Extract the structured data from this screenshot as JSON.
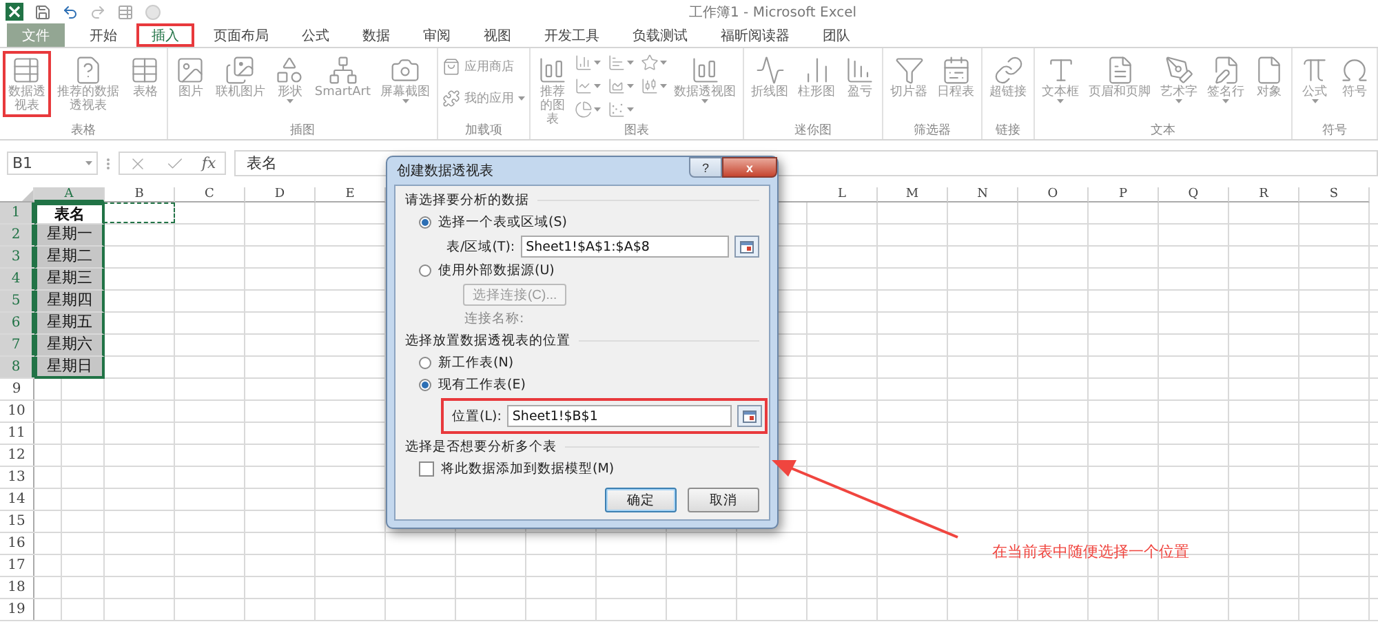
{
  "title_bar": {
    "title": "工作簿1 - Microsoft Excel"
  },
  "tabs": [
    {
      "label": "文件",
      "kind": "file",
      "selected": false,
      "highlighted": false
    },
    {
      "label": "开始",
      "kind": "tab",
      "selected": false,
      "highlighted": false
    },
    {
      "label": "插入",
      "kind": "tab",
      "selected": true,
      "highlighted": true
    },
    {
      "label": "页面布局",
      "kind": "tab",
      "selected": false,
      "highlighted": false
    },
    {
      "label": "公式",
      "kind": "tab",
      "selected": false,
      "highlighted": false
    },
    {
      "label": "数据",
      "kind": "tab",
      "selected": false,
      "highlighted": false
    },
    {
      "label": "审阅",
      "kind": "tab",
      "selected": false,
      "highlighted": false
    },
    {
      "label": "视图",
      "kind": "tab",
      "selected": false,
      "highlighted": false
    },
    {
      "label": "开发工具",
      "kind": "tab",
      "selected": false,
      "highlighted": false
    },
    {
      "label": "负载测试",
      "kind": "tab",
      "selected": false,
      "highlighted": false
    },
    {
      "label": "福昕阅读器",
      "kind": "tab",
      "selected": false,
      "highlighted": false
    },
    {
      "label": "团队",
      "kind": "tab",
      "selected": false,
      "highlighted": false
    }
  ],
  "ribbon_groups": [
    {
      "label": "表格",
      "buttons": [
        {
          "kind": "large",
          "label": "数据透视表",
          "dropdown": false,
          "highlighted": true
        },
        {
          "kind": "large",
          "label": "推荐的数据透视表",
          "dropdown": false,
          "highlighted": false
        },
        {
          "kind": "large",
          "label": "表格",
          "dropdown": false,
          "highlighted": false
        }
      ]
    },
    {
      "label": "插图",
      "buttons": [
        {
          "kind": "large",
          "label": "图片",
          "dropdown": false,
          "highlighted": false
        },
        {
          "kind": "large",
          "label": "联机图片",
          "dropdown": false,
          "highlighted": false
        },
        {
          "kind": "large",
          "label": "形状",
          "dropdown": true,
          "highlighted": false
        },
        {
          "kind": "large",
          "label": "SmartArt",
          "dropdown": false,
          "highlighted": false
        },
        {
          "kind": "large",
          "label": "屏幕截图",
          "dropdown": true,
          "highlighted": false
        }
      ]
    },
    {
      "label": "加载项",
      "buttons": [
        {
          "kind": "small",
          "label": "应用商店",
          "dropdown": false,
          "highlighted": false
        },
        {
          "kind": "small",
          "label": "我的应用",
          "dropdown": true,
          "highlighted": false
        }
      ]
    },
    {
      "label": "图表",
      "buttons": [
        {
          "kind": "large",
          "label": "推荐的图表",
          "dropdown": false,
          "highlighted": false
        },
        {
          "kind": "icon",
          "dropdown": true,
          "highlighted": false
        },
        {
          "kind": "icon",
          "dropdown": true,
          "highlighted": false
        },
        {
          "kind": "icon",
          "dropdown": true,
          "highlighted": false
        },
        {
          "kind": "icon",
          "dropdown": true,
          "highlighted": false
        },
        {
          "kind": "icon",
          "dropdown": true,
          "highlighted": false
        },
        {
          "kind": "icon",
          "dropdown": true,
          "highlighted": false
        },
        {
          "kind": "icon",
          "dropdown": true,
          "highlighted": false
        },
        {
          "kind": "icon",
          "dropdown": true,
          "highlighted": false
        },
        {
          "kind": "large",
          "label": "数据透视图",
          "dropdown": true,
          "highlighted": false
        }
      ]
    },
    {
      "label": "迷你图",
      "buttons": [
        {
          "kind": "large",
          "label": "折线图",
          "dropdown": false,
          "highlighted": false
        },
        {
          "kind": "large",
          "label": "柱形图",
          "dropdown": false,
          "highlighted": false
        },
        {
          "kind": "large",
          "label": "盈亏",
          "dropdown": false,
          "highlighted": false
        }
      ]
    },
    {
      "label": "筛选器",
      "buttons": [
        {
          "kind": "large",
          "label": "切片器",
          "dropdown": false,
          "highlighted": false
        },
        {
          "kind": "large",
          "label": "日程表",
          "dropdown": false,
          "highlighted": false
        }
      ]
    },
    {
      "label": "链接",
      "buttons": [
        {
          "kind": "large",
          "label": "超链接",
          "dropdown": false,
          "highlighted": false
        }
      ]
    },
    {
      "label": "文本",
      "buttons": [
        {
          "kind": "large",
          "label": "文本框",
          "dropdown": true,
          "highlighted": false
        },
        {
          "kind": "large",
          "label": "页眉和页脚",
          "dropdown": false,
          "highlighted": false
        },
        {
          "kind": "large",
          "label": "艺术字",
          "dropdown": true,
          "highlighted": false
        },
        {
          "kind": "large",
          "label": "签名行",
          "dropdown": true,
          "highlighted": false
        },
        {
          "kind": "large",
          "label": "对象",
          "dropdown": false,
          "highlighted": false
        }
      ]
    },
    {
      "label": "符号",
      "buttons": [
        {
          "kind": "large",
          "label": "公式",
          "dropdown": true,
          "highlighted": false
        },
        {
          "kind": "large",
          "label": "符号",
          "dropdown": false,
          "highlighted": false
        }
      ]
    }
  ],
  "formula_bar": {
    "name_box": "B1",
    "fx_label": "fx",
    "content": "表名"
  },
  "sheet": {
    "columns_left": [
      {
        "label": "A",
        "selected": true
      },
      {
        "label": "B",
        "selected": false
      },
      {
        "label": "C",
        "selected": false
      },
      {
        "label": "D",
        "selected": false
      },
      {
        "label": "E",
        "selected": false
      }
    ],
    "columns_right": [
      {
        "label": "L",
        "selected": false
      },
      {
        "label": "M",
        "selected": false
      },
      {
        "label": "N",
        "selected": false
      },
      {
        "label": "O",
        "selected": false
      },
      {
        "label": "P",
        "selected": false
      },
      {
        "label": "Q",
        "selected": false
      },
      {
        "label": "R",
        "selected": false
      },
      {
        "label": "S",
        "selected": false
      }
    ],
    "rows": [
      {
        "label": "1",
        "selected": true,
        "cells": [
          {
            "text": "表名",
            "selected": true,
            "active": true,
            "bold": true
          },
          {
            "copy_marquee": true
          }
        ]
      },
      {
        "label": "2",
        "selected": true,
        "cells": [
          {
            "text": "星期一",
            "selected": true,
            "active": false,
            "bold": false
          }
        ]
      },
      {
        "label": "3",
        "selected": true,
        "cells": [
          {
            "text": "星期二",
            "selected": true,
            "active": false,
            "bold": false
          }
        ]
      },
      {
        "label": "4",
        "selected": true,
        "cells": [
          {
            "text": "星期三",
            "selected": true,
            "active": false,
            "bold": false
          }
        ]
      },
      {
        "label": "5",
        "selected": true,
        "cells": [
          {
            "text": "星期四",
            "selected": true,
            "active": false,
            "bold": false
          }
        ]
      },
      {
        "label": "6",
        "selected": true,
        "cells": [
          {
            "text": "星期五",
            "selected": true,
            "active": false,
            "bold": false
          }
        ]
      },
      {
        "label": "7",
        "selected": true,
        "cells": [
          {
            "text": "星期六",
            "selected": true,
            "active": false,
            "bold": false
          }
        ]
      },
      {
        "label": "8",
        "selected": true,
        "cells": [
          {
            "text": "星期日",
            "selected": true,
            "active": false,
            "bold": false
          }
        ]
      },
      {
        "label": "9",
        "selected": false,
        "cells": []
      },
      {
        "label": "10",
        "selected": false,
        "cells": []
      },
      {
        "label": "11",
        "selected": false,
        "cells": []
      },
      {
        "label": "12",
        "selected": false,
        "cells": []
      },
      {
        "label": "13",
        "selected": false,
        "cells": []
      },
      {
        "label": "14",
        "selected": false,
        "cells": []
      },
      {
        "label": "15",
        "selected": false,
        "cells": []
      },
      {
        "label": "16",
        "selected": false,
        "cells": []
      },
      {
        "label": "17",
        "selected": false,
        "cells": []
      },
      {
        "label": "18",
        "selected": false,
        "cells": []
      },
      {
        "label": "19",
        "selected": false,
        "cells": []
      }
    ]
  },
  "dialog": {
    "title": "创建数据透视表",
    "help_button": "?",
    "close_button": "x",
    "sections": [
      {
        "heading": "请选择要分析的数据",
        "items": [
          {
            "kind": "radio",
            "label": "选择一个表或区域(S)",
            "selected": true
          },
          {
            "kind": "field",
            "label": "表/区域(T):",
            "value": "Sheet1!$A$1:$A$8",
            "highlighted": false
          },
          {
            "kind": "radio",
            "label": "使用外部数据源(U)",
            "selected": false
          },
          {
            "kind": "button",
            "label": "选择连接(C)...",
            "disabled": true
          },
          {
            "kind": "note",
            "label": "连接名称:",
            "disabled": true
          }
        ]
      },
      {
        "heading": "选择放置数据透视表的位置",
        "items": [
          {
            "kind": "radio",
            "label": "新工作表(N)",
            "selected": false
          },
          {
            "kind": "radio",
            "label": "现有工作表(E)",
            "selected": true
          },
          {
            "kind": "field",
            "label": "位置(L):",
            "value": "Sheet1!$B$1",
            "highlighted": true
          }
        ]
      },
      {
        "heading": "选择是否想要分析多个表",
        "items": [
          {
            "kind": "checkbox",
            "label": "将此数据添加到数据模型(M)",
            "checked": false
          }
        ]
      }
    ],
    "buttons": [
      {
        "label": "确定",
        "default": true
      },
      {
        "label": "取消",
        "default": false
      }
    ]
  },
  "annotation": {
    "text": "在当前表中随便选择一个位置"
  }
}
